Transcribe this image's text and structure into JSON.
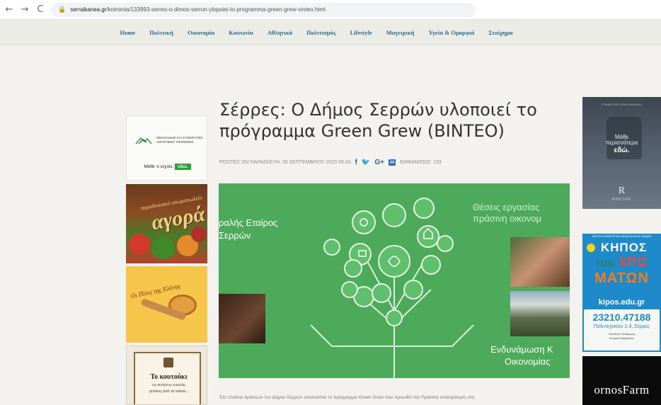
{
  "browser": {
    "back_glyph": "←",
    "forward_glyph": "→",
    "reload_glyph": "C",
    "lock_glyph": "🔒",
    "url_domain": "serraikanea.gr",
    "url_path": "/koinonia/133993-serres-o-dimos-serron-ylopoiei-to-programma-green-grew-vinteo.html"
  },
  "nav": {
    "items": [
      "Home",
      "Πολιτική",
      "Οικονομία",
      "Κοινωνία",
      "Αθλητικά",
      "Πολιτισμός",
      "Lifestyle",
      "Μαγειρική",
      "Υγεία & Ομορφιά",
      "Στοίχημα"
    ]
  },
  "article": {
    "title": "Σέρρες: Ο Δήμος Σερρών υλοποιεί το πρόγραμμα Green Grew (ΒΙΝΤΕΟ)",
    "posted": "POSTED ON ΠΑΡΑΣΚΕΥΗ, 25 ΣΕΠΤΕΜΒΡΙΟΥ 2020 00:24",
    "share": {
      "facebook": "f",
      "twitter": "🐦",
      "google_plus": "G+",
      "linkedin": "in"
    },
    "views": "ΕΜΦΑΝΙΣΕΙΣ: 133",
    "intro": "Στο πλαίσιο δράσεων του Δήμου Σερρών υλοποιείται το πρόγραμμα Green Grew που προωθεί την Πράσινη απασχόληση στη"
  },
  "hero": {
    "left_top": "ραλής Εταίρος",
    "left_bottom": "Σερρών",
    "right_top": "Θέσεις εργασίας",
    "right_mid": "πράσινη οικονομ",
    "right_bottom1": "Ενδυνάμωση Κ",
    "right_bottom2": "Οικονομίας",
    "bg_color": "#4caa5a"
  },
  "ads": {
    "left1": {
      "brand": "ΜΙΧΑΗΛΙΔΗΣ ΚΑΙ ΣΥΝΕΡΓΑΤΕΣ\nΛΟΓΙΣΤΙΚΕΣ ΥΠΗΡΕΣΙΕΣ",
      "tagline": "Μάθε τι ισχύει,",
      "cta": "εδώ."
    },
    "left2": {
      "small": "παραδοσιακό οπωροπωλείο",
      "big": "αγορά"
    },
    "left3": {
      "text": "Οι Πίτες της Ελένης"
    },
    "left4": {
      "title": "Το κουτούκι",
      "sub": "του Μπάμπου Ανατολής",
      "sub2": "γεύσεις από τα παλιά..."
    },
    "right1": {
      "top": "ΣΥΜΒΟΥΛΟΙ ΕΠΙΚΟΙΝΩΝΙΑΣ",
      "line1": "Μάθε",
      "line2": "περισσότερα",
      "line3": "εδώ.",
      "logo": "R",
      "brand": "RHETOR"
    },
    "right2": {
      "top": "ΚΕΝΤΡΟ ΔΗΜΙΟΥΡΓΙΚΗΣ ΑΠΑΣΧΟΛΗΣΗΣ ΠΑΙΔΙΩΝ",
      "k1": "ΚΗΠΟΣ",
      "k2a": "ΤΩΝ",
      "k2b": "ΧΡΩ",
      "k3": "ΜΑΤΩΝ",
      "site": "kipos.edu.gr",
      "phone": "23210.47188",
      "addr": "Πολυτεχνείου 1-3, Σέρρες",
      "s1": "Υπεύθυνη Παιδαγωγός",
      "s2": "Κατερίνα Μιχαηλίδου"
    },
    "right3": {
      "text": "ornosFarm"
    }
  }
}
